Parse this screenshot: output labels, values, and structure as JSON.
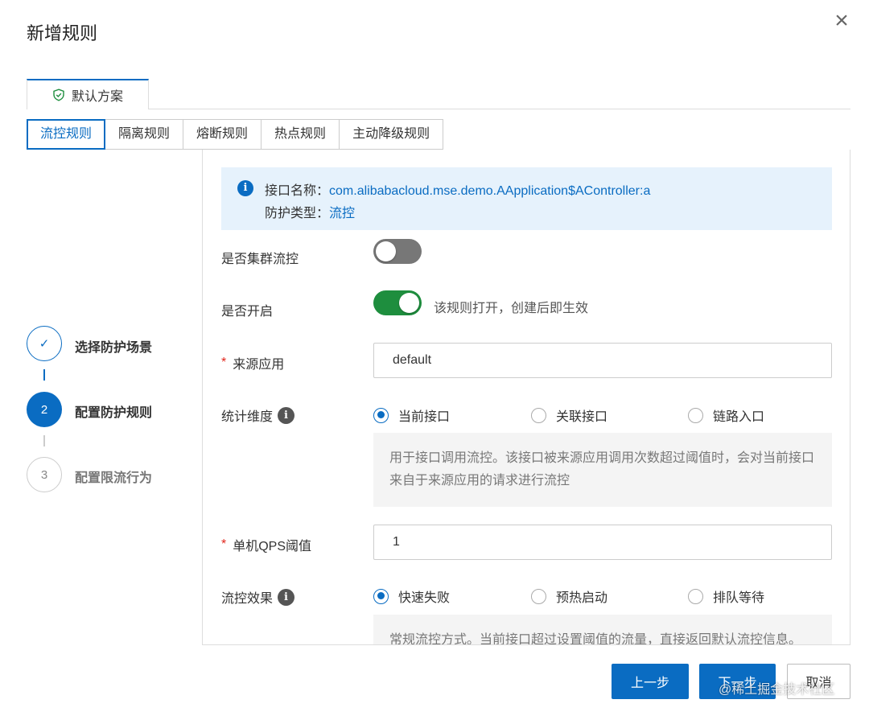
{
  "dialog": {
    "title": "新增规则",
    "close_icon": "close-icon"
  },
  "scheme_tab": {
    "label": "默认方案",
    "icon": "shield-check-icon"
  },
  "rule_tabs": [
    {
      "label": "流控规则",
      "active": true
    },
    {
      "label": "隔离规则",
      "active": false
    },
    {
      "label": "熔断规则",
      "active": false
    },
    {
      "label": "热点规则",
      "active": false
    },
    {
      "label": "主动降级规则",
      "active": false
    }
  ],
  "steps": [
    {
      "marker": "✓",
      "label": "选择防护场景",
      "state": "done"
    },
    {
      "marker": "2",
      "label": "配置防护规则",
      "state": "active"
    },
    {
      "marker": "3",
      "label": "配置限流行为",
      "state": "todo"
    }
  ],
  "info": {
    "icon_glyph": "i",
    "line1_label": "接口名称：",
    "line1_value": "com.alibabacloud.mse.demo.AApplication$AController:a",
    "line2_label": "防护类型：",
    "line2_value": "流控"
  },
  "form": {
    "cluster": {
      "label": "是否集群流控",
      "enabled": false
    },
    "enable": {
      "label": "是否开启",
      "enabled": true,
      "hint": "该规则打开，创建后即生效"
    },
    "source_app": {
      "required_mark": "*",
      "label": "来源应用",
      "value": "default"
    },
    "stat_dimension": {
      "label": "统计维度",
      "info_glyph": "i",
      "options": [
        {
          "label": "当前接口",
          "selected": true
        },
        {
          "label": "关联接口",
          "selected": false
        },
        {
          "label": "链路入口",
          "selected": false
        }
      ],
      "description": "用于接口调用流控。该接口被来源应用调用次数超过阈值时，会对当前接口来自于来源应用的请求进行流控"
    },
    "qps": {
      "required_mark": "*",
      "label": "单机QPS阈值",
      "value": "1"
    },
    "control_effect": {
      "label": "流控效果",
      "info_glyph": "i",
      "options": [
        {
          "label": "快速失败",
          "selected": true
        },
        {
          "label": "预热启动",
          "selected": false
        },
        {
          "label": "排队等待",
          "selected": false
        }
      ],
      "description": "常规流控方式。当前接口超过设置阈值的流量，直接返回默认流控信息。"
    }
  },
  "footer": {
    "prev_label": "上一步",
    "next_label": "下一步",
    "cancel_label": "取消",
    "watermark": "@稀土掘金技术社区"
  },
  "colors": {
    "primary": "#0a6cc2",
    "switch_on": "#1e8e3e",
    "required": "#e1251b",
    "info_bg": "#e6f2fc"
  }
}
